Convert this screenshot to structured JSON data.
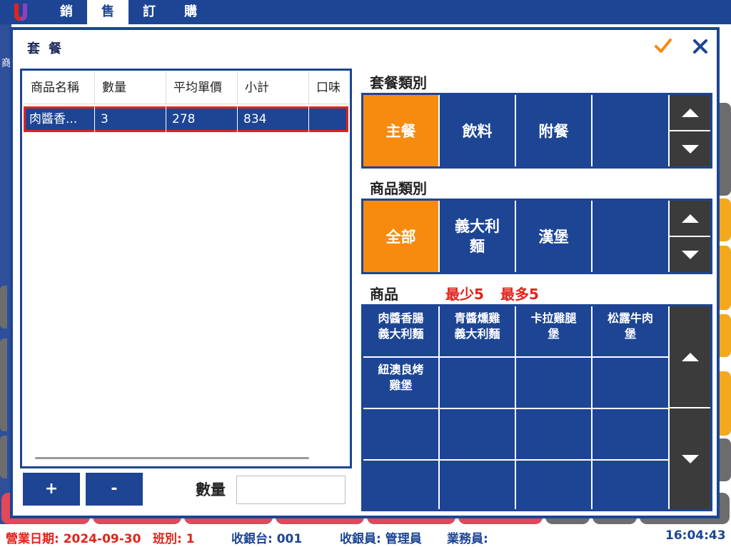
{
  "app": {
    "logo_icon": "app-logo-icon",
    "menu": [
      "銷",
      "售",
      "訂",
      "購"
    ],
    "background_glyph": "商"
  },
  "dialog": {
    "title": "套餐",
    "confirm_icon": "checkmark-icon",
    "close_icon": "close-icon"
  },
  "order_table": {
    "columns": [
      "商品名稱",
      "數量",
      "平均單價",
      "小計",
      "口味"
    ],
    "rows": [
      {
        "name": "肉醬香...",
        "qty": "3",
        "avg_price": "278",
        "subtotal": "834",
        "flavor": ""
      }
    ]
  },
  "controls": {
    "plus_label": "+",
    "minus_label": "-",
    "qty_label": "數量",
    "qty_value": ""
  },
  "set_category": {
    "title": "套餐類別",
    "items": [
      "主餐",
      "飲料",
      "附餐",
      ""
    ],
    "selected": "主餐"
  },
  "product_category": {
    "title": "商品類別",
    "items": [
      "全部",
      "義大利\n麵",
      "漢堡",
      ""
    ],
    "selected": "全部"
  },
  "products": {
    "title": "商品",
    "rule_min": "最少5",
    "rule_max": "最多5",
    "items": [
      "肉醬香腸\n義大利麵",
      "青醬燻雞\n義大利麵",
      "卡拉雞腿\n堡",
      "松露牛肉\n堡",
      "紐澳良烤\n雞堡"
    ]
  },
  "status": {
    "business_date": "營業日期: 2024-09-30",
    "shift": "班別: 1",
    "register": "收銀台: 001",
    "cashier": "收銀員: 管理員",
    "salesperson": "業務員:",
    "time": "16:04:43"
  },
  "colors": {
    "primary": "#1d4594",
    "selected": "#f68b0f",
    "alert": "#e2231a",
    "arrow_panel": "#3b3b3b"
  }
}
